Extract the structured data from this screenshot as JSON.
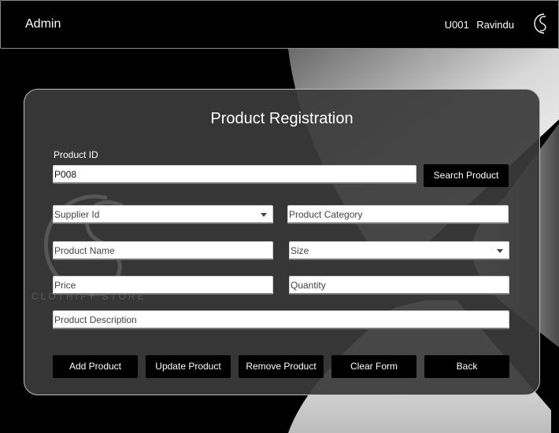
{
  "header": {
    "title": "Admin",
    "user_id": "U001",
    "user_name": "Ravindu"
  },
  "panel": {
    "title": "Product Registration",
    "watermark_text": "CLOTHIFY STORE"
  },
  "form": {
    "product_id_label": "Product ID",
    "product_id_value": "P008",
    "supplier_placeholder": "Supplier Id",
    "category_placeholder": "Product Category",
    "name_placeholder": "Product Name",
    "size_placeholder": "Size",
    "price_placeholder": "Price",
    "quantity_placeholder": "Quantity",
    "description_placeholder": "Product Description"
  },
  "buttons": {
    "search": "Search Product",
    "add": "Add Product",
    "update": "Update Product",
    "remove": "Remove Product",
    "clear": "Clear Form",
    "back": "Back"
  },
  "colors": {
    "background": "#000000",
    "panel": "#3a3a3a",
    "button": "#000000",
    "field": "#ffffff"
  },
  "icons": {
    "logo": "cs-logo-icon",
    "dropdown": "chevron-down-icon"
  }
}
